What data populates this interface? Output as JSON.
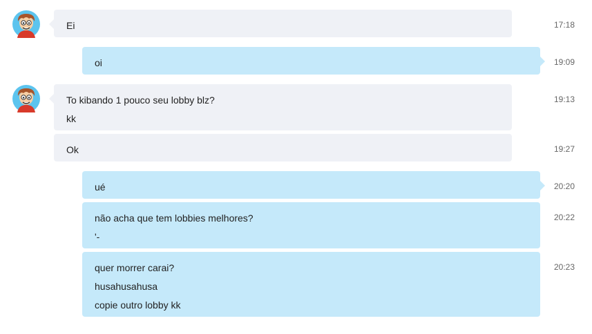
{
  "contact": {
    "avatar_icon": "cartoon-boy-avatar-icon"
  },
  "colors": {
    "incoming_bubble": "#eff1f6",
    "outgoing_bubble": "#c5e9fa"
  },
  "messages": [
    {
      "direction": "in",
      "lines": [
        "Ei"
      ],
      "time": "17:18"
    },
    {
      "direction": "out",
      "lines": [
        "oi"
      ],
      "time": "19:09"
    },
    {
      "direction": "in",
      "lines": [
        "To kibando 1 pouco seu lobby blz?",
        "kk"
      ],
      "time": "19:13"
    },
    {
      "direction": "in",
      "lines": [
        "Ok"
      ],
      "time": "19:27"
    },
    {
      "direction": "out",
      "lines": [
        "ué"
      ],
      "time": "20:20"
    },
    {
      "direction": "out",
      "lines": [
        "não acha que tem lobbies melhores?",
        "'-"
      ],
      "time": "20:22"
    },
    {
      "direction": "out",
      "lines": [
        "quer morrer carai?",
        "husahusahusa",
        "copie outro lobby kk"
      ],
      "time": "20:23"
    }
  ]
}
